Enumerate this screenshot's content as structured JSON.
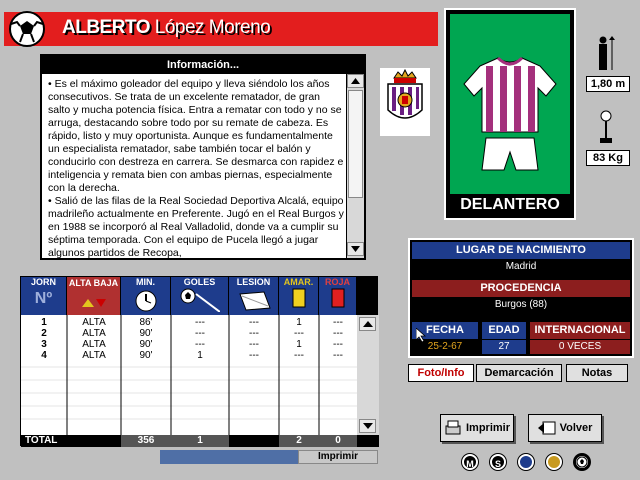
{
  "header": {
    "first_name": "ALBERTO",
    "last_name": "López Moreno"
  },
  "info": {
    "title": "Información...",
    "paragraphs": [
      "• Es el máximo goleador del equipo y lleva siéndolo los años consecutivos. Se trata de un excelente rematador, de gran salto y mucha potencia física. Entra a rematar con todo y no se arruga, destacando sobre todo por su remate de cabeza. Es rápido, listo y muy oportunista. Aunque es fundamentalmente un especialista rematador, sabe también tocar el balón y conducirlo con destreza en carrera. Se desmarca con rapidez e inteligencia y remata bien con ambas piernas, especialmente con la derecha.",
      "• Salió de las filas de la Real Sociedad Deportiva Alcalá, equipo madrileño actualmente en Preferente. Jugó en el Real Burgos y en 1988 se incorporó al Real Valladolid, donde va a cumplir su séptima temporada. Con el equipo de Pucela llegó a jugar algunos partidos de Recopa,"
    ]
  },
  "player": {
    "position": "DELANTERO",
    "height": "1,80 m",
    "weight": "83 Kg"
  },
  "birth": {
    "birthplace_label": "LUGAR DE NACIMIENTO",
    "birthplace": "Madrid",
    "origin_label": "PROCEDENCIA",
    "origin": "Burgos (88)",
    "date_label": "FECHA",
    "date": "25-2-67",
    "age_label": "EDAD",
    "age": "27",
    "intl_label": "INTERNACIONAL",
    "intl": "0 VECES"
  },
  "tabs": {
    "photo": "Foto/Info",
    "position": "Demarcación",
    "notes": "Notas"
  },
  "table": {
    "headers": {
      "round": "JORN",
      "round_sub": "Nº",
      "status": "ALTA BAJA",
      "minutes": "MIN.",
      "goals": "GOLES",
      "injury": "LESION",
      "yellow": "AMAR.",
      "red": "ROJA"
    },
    "rows": [
      {
        "round": "1",
        "status": "ALTA",
        "minutes": "86'",
        "goals": "---",
        "injury": "---",
        "yellow": "1",
        "red": "---"
      },
      {
        "round": "2",
        "status": "ALTA",
        "minutes": "90'",
        "goals": "---",
        "injury": "---",
        "yellow": "---",
        "red": "---"
      },
      {
        "round": "3",
        "status": "ALTA",
        "minutes": "90'",
        "goals": "---",
        "injury": "---",
        "yellow": "1",
        "red": "---"
      },
      {
        "round": "4",
        "status": "ALTA",
        "minutes": "90'",
        "goals": "1",
        "injury": "---",
        "yellow": "---",
        "red": "---"
      }
    ],
    "totals": {
      "label": "TOTAL",
      "minutes": "356",
      "goals": "1",
      "yellow": "2",
      "red": "0"
    },
    "print_label": "Imprimir"
  },
  "buttons": {
    "print": "Imprimir",
    "back": "Volver"
  },
  "bottom_icons": [
    "M",
    "S"
  ],
  "colors": {
    "header_red": "#e31e1e",
    "pitch_green": "#00a651",
    "table_blue": "#1e3c8c"
  }
}
